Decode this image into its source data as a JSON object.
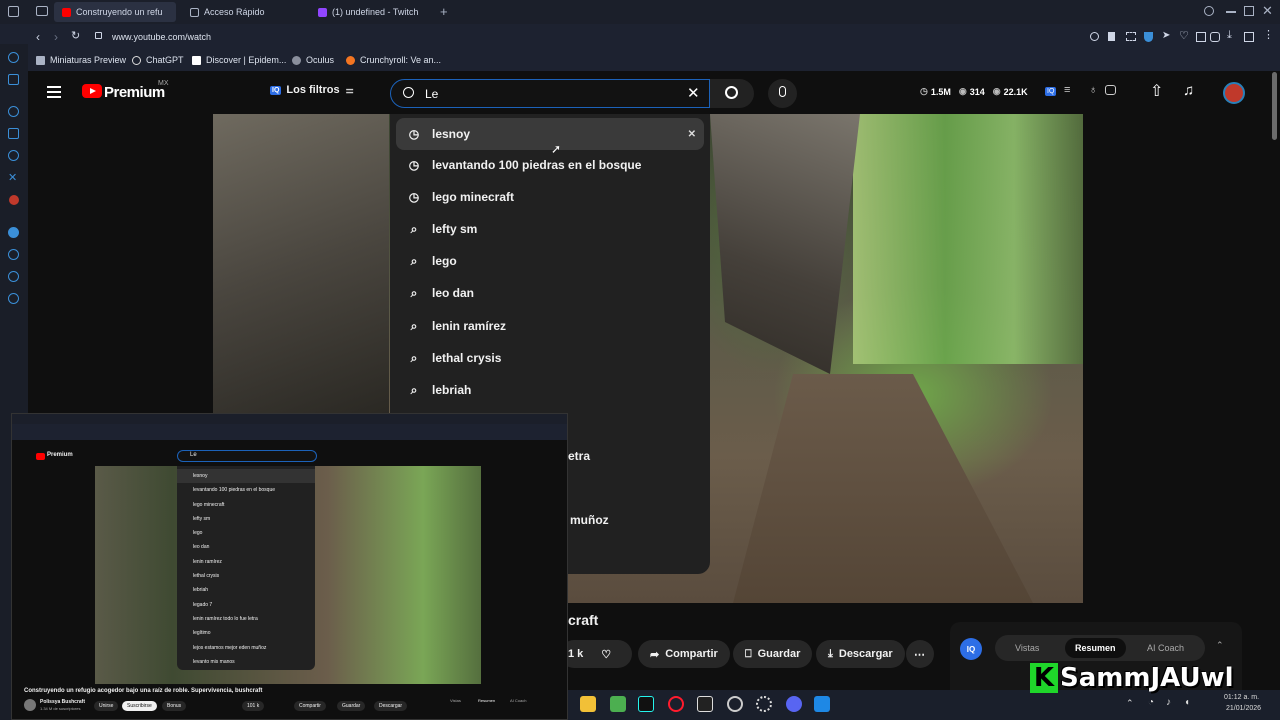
{
  "browser": {
    "tabs": [
      {
        "label": "Construyendo un refu",
        "active": true,
        "icon": "youtube-icon"
      },
      {
        "label": "Acceso Rápido",
        "active": false,
        "icon": "grid-icon"
      },
      {
        "label": "(1) undefined - Twitch",
        "active": false,
        "icon": "twitch-icon"
      }
    ],
    "url": "www.youtube.com/watch",
    "bookmarks": [
      "Miniaturas Preview",
      "ChatGPT",
      "Discover | Epidem...",
      "Oculus",
      "Crunchyroll: Ve an..."
    ]
  },
  "youtube": {
    "logo_text": "Premium",
    "logo_region": "MX",
    "filters_label": "Los filtros",
    "filters_badge": "IQ",
    "search_value": "Le",
    "stats": {
      "views": "1.5M",
      "likes": "314",
      "subs": "22.1K"
    },
    "suggestions": [
      {
        "text": "lesnoy",
        "type": "history"
      },
      {
        "text": "levantando 100 piedras en el bosque",
        "type": "history"
      },
      {
        "text": "lego minecraft",
        "type": "history"
      },
      {
        "text": "lefty sm",
        "type": "search"
      },
      {
        "text": "lego",
        "type": "search"
      },
      {
        "text": "leo dan",
        "type": "search"
      },
      {
        "text": "lenin ramírez",
        "type": "search"
      },
      {
        "text": "lethal crysis",
        "type": "search"
      },
      {
        "text": "lebriah",
        "type": "search"
      }
    ],
    "title_fragment": "craft",
    "partial_1": "etra",
    "partial_2": "muñoz",
    "likes_fragment": "1 k",
    "actions": {
      "share": "Compartir",
      "save": "Guardar",
      "download": "Descargar"
    },
    "panel_tabs": [
      "Vistas",
      "Resumen",
      "AI Coach"
    ],
    "panel_badge": "IQ"
  },
  "cam": {
    "channel": "Polissya Bushcraft",
    "subs": "1.34 M de suscriptores",
    "join": "Unirse",
    "subscribe": "Suscribirse",
    "bonus": "Bonus",
    "title": "Construyendo un refugio acogedor bajo una raíz de roble. Supervivencia, bushcraft",
    "likes": "101 k",
    "suggestions": [
      "lesnoy",
      "levantando 100 piedras en el bosque",
      "lego minecraft",
      "lefty sm",
      "lego",
      "leo dan",
      "lenin ramírez",
      "lethal crysis",
      "lebriah",
      "legado 7",
      "lenin ramírez todo lo fue letra",
      "legítimo",
      "lejos estamos mejor eden muñoz",
      "levanto mis manos"
    ]
  },
  "taskbar": {
    "time": "01:12 a. m.",
    "date": "21/01/2026"
  },
  "watermark": {
    "letter": "K",
    "text": "SammJAUwl"
  },
  "colors": {
    "accent": "#1c62b9",
    "yt_red": "#ff0000",
    "wm_green": "#1fd62a"
  }
}
